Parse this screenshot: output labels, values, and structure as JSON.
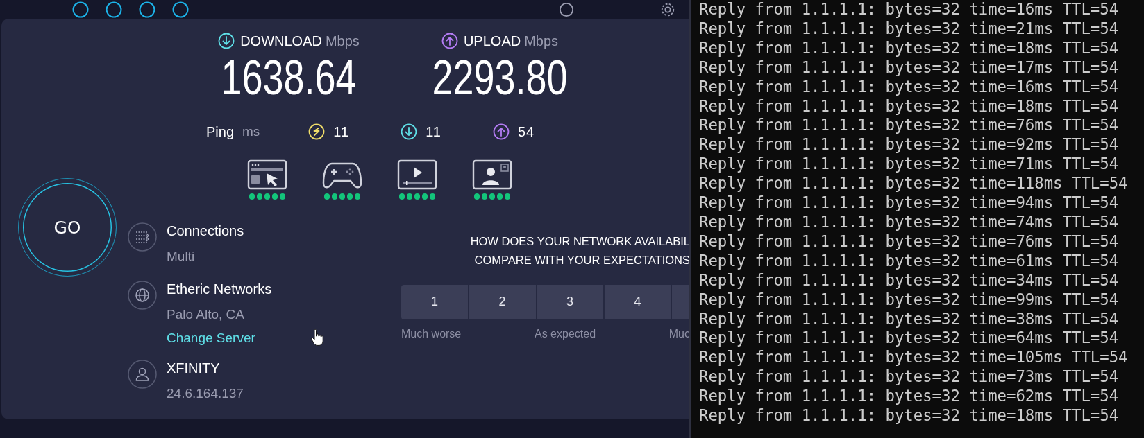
{
  "speedtest": {
    "download": {
      "label": "DOWNLOAD",
      "unit": "Mbps",
      "value": "1638.64"
    },
    "upload": {
      "label": "UPLOAD",
      "unit": "Mbps",
      "value": "2293.80"
    },
    "ping": {
      "label": "Ping",
      "unit": "ms",
      "readings": [
        {
          "kind": "idle",
          "value": "11"
        },
        {
          "kind": "download",
          "value": "11"
        },
        {
          "kind": "upload",
          "value": "54"
        }
      ]
    },
    "usage": [
      {
        "kind": "browsing",
        "stars": 5
      },
      {
        "kind": "gaming",
        "stars": 5
      },
      {
        "kind": "streaming",
        "stars": 5
      },
      {
        "kind": "video_call",
        "stars": 5
      }
    ],
    "go_button": "GO",
    "info": [
      {
        "kind": "connections",
        "title": "Connections",
        "detail": "Multi"
      },
      {
        "kind": "server",
        "title": "Etheric Networks",
        "detail": "Palo Alto, CA",
        "link": "Change Server"
      },
      {
        "kind": "provider",
        "title": "XFINITY",
        "detail": "24.6.164.137"
      }
    ],
    "survey": {
      "question_lines": [
        "HOW DOES YOUR NETWORK AVAILABIL",
        "COMPARE WITH YOUR EXPECTATIONS"
      ],
      "options": [
        "1",
        "2",
        "3",
        "4"
      ],
      "scale_labels": [
        "Much worse",
        "As expected",
        "Muc"
      ]
    }
  },
  "terminal": {
    "lines": [
      "Reply from 1.1.1.1: bytes=32 time=16ms TTL=54",
      "Reply from 1.1.1.1: bytes=32 time=21ms TTL=54",
      "Reply from 1.1.1.1: bytes=32 time=18ms TTL=54",
      "Reply from 1.1.1.1: bytes=32 time=17ms TTL=54",
      "Reply from 1.1.1.1: bytes=32 time=16ms TTL=54",
      "Reply from 1.1.1.1: bytes=32 time=18ms TTL=54",
      "Reply from 1.1.1.1: bytes=32 time=76ms TTL=54",
      "Reply from 1.1.1.1: bytes=32 time=92ms TTL=54",
      "Reply from 1.1.1.1: bytes=32 time=71ms TTL=54",
      "Reply from 1.1.1.1: bytes=32 time=118ms TTL=54",
      "Reply from 1.1.1.1: bytes=32 time=94ms TTL=54",
      "Reply from 1.1.1.1: bytes=32 time=74ms TTL=54",
      "Reply from 1.1.1.1: bytes=32 time=76ms TTL=54",
      "Reply from 1.1.1.1: bytes=32 time=61ms TTL=54",
      "Reply from 1.1.1.1: bytes=32 time=34ms TTL=54",
      "Reply from 1.1.1.1: bytes=32 time=99ms TTL=54",
      "Reply from 1.1.1.1: bytes=32 time=38ms TTL=54",
      "Reply from 1.1.1.1: bytes=32 time=64ms TTL=54",
      "Reply from 1.1.1.1: bytes=32 time=105ms TTL=54",
      "Reply from 1.1.1.1: bytes=32 time=73ms TTL=54",
      "Reply from 1.1.1.1: bytes=32 time=62ms TTL=54",
      "Reply from 1.1.1.1: bytes=32 time=18ms TTL=54"
    ]
  }
}
